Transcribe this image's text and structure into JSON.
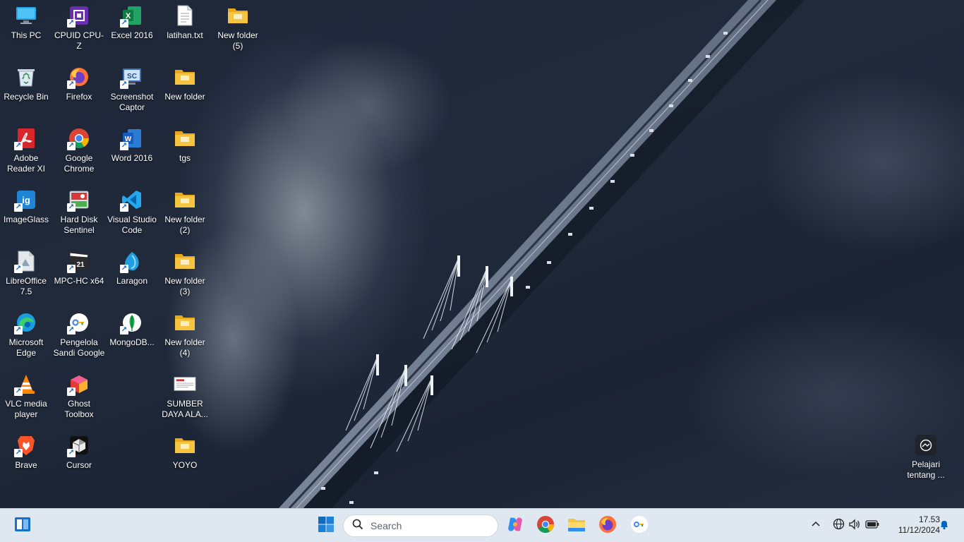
{
  "desktop": {
    "icons": [
      {
        "label": "This PC",
        "icon": "monitor-icon"
      },
      {
        "label": "CPUID CPU-Z",
        "icon": "cpu-z-icon"
      },
      {
        "label": "Excel 2016",
        "icon": "excel-icon"
      },
      {
        "label": "latihan.txt",
        "icon": "text-file-icon"
      },
      {
        "label": "New folder (5)",
        "icon": "folder-icon"
      },
      {
        "label": "Recycle Bin",
        "icon": "recycle-bin-icon"
      },
      {
        "label": "Firefox",
        "icon": "firefox-icon"
      },
      {
        "label": "Screenshot Captor",
        "icon": "screenshot-captor-icon"
      },
      {
        "label": "New folder",
        "icon": "folder-icon"
      },
      {
        "label": "Adobe Reader XI",
        "icon": "adobe-reader-icon"
      },
      {
        "label": "Google Chrome",
        "icon": "chrome-icon"
      },
      {
        "label": "Word 2016",
        "icon": "word-icon"
      },
      {
        "label": "tgs",
        "icon": "folder-icon"
      },
      {
        "label": "ImageGlass",
        "icon": "imageglass-icon"
      },
      {
        "label": "Hard Disk Sentinel",
        "icon": "hard-disk-sentinel-icon"
      },
      {
        "label": "Visual Studio Code",
        "icon": "vscode-icon"
      },
      {
        "label": "New folder (2)",
        "icon": "folder-icon"
      },
      {
        "label": "LibreOffice 7.5",
        "icon": "libreoffice-icon"
      },
      {
        "label": "MPC-HC x64",
        "icon": "mpc-hc-icon"
      },
      {
        "label": "Laragon",
        "icon": "laragon-icon"
      },
      {
        "label": "New folder (3)",
        "icon": "folder-icon"
      },
      {
        "label": "Microsoft Edge",
        "icon": "edge-icon"
      },
      {
        "label": "Pengelola Sandi Google",
        "icon": "password-manager-icon"
      },
      {
        "label": "MongoDB...",
        "icon": "mongodb-icon"
      },
      {
        "label": "New folder (4)",
        "icon": "folder-icon"
      },
      {
        "label": "VLC media player",
        "icon": "vlc-icon"
      },
      {
        "label": "Ghost Toolbox",
        "icon": "ghost-toolbox-icon"
      },
      {
        "label": "SUMBER DAYA ALA...",
        "icon": "document-thumbnail-icon"
      },
      {
        "label": "Brave",
        "icon": "brave-icon"
      },
      {
        "label": "Cursor",
        "icon": "cursor-app-icon"
      },
      {
        "label": "YOYO",
        "icon": "folder-icon"
      }
    ],
    "spotlight_label": "Pelajari tentang ..."
  },
  "taskbar": {
    "search_placeholder": "Search",
    "pinned": [
      "widgets-icon",
      "start-icon",
      "copilot-icon",
      "chrome-icon",
      "file-explorer-icon",
      "firefox-icon",
      "password-manager-icon"
    ],
    "tray": {
      "time": "17.53",
      "date": "11/12/2024"
    }
  },
  "colors": {
    "taskbar_bg": "#dfe7f1",
    "folder_yellow": "#f5c542",
    "accent_blue": "#0067c0"
  }
}
